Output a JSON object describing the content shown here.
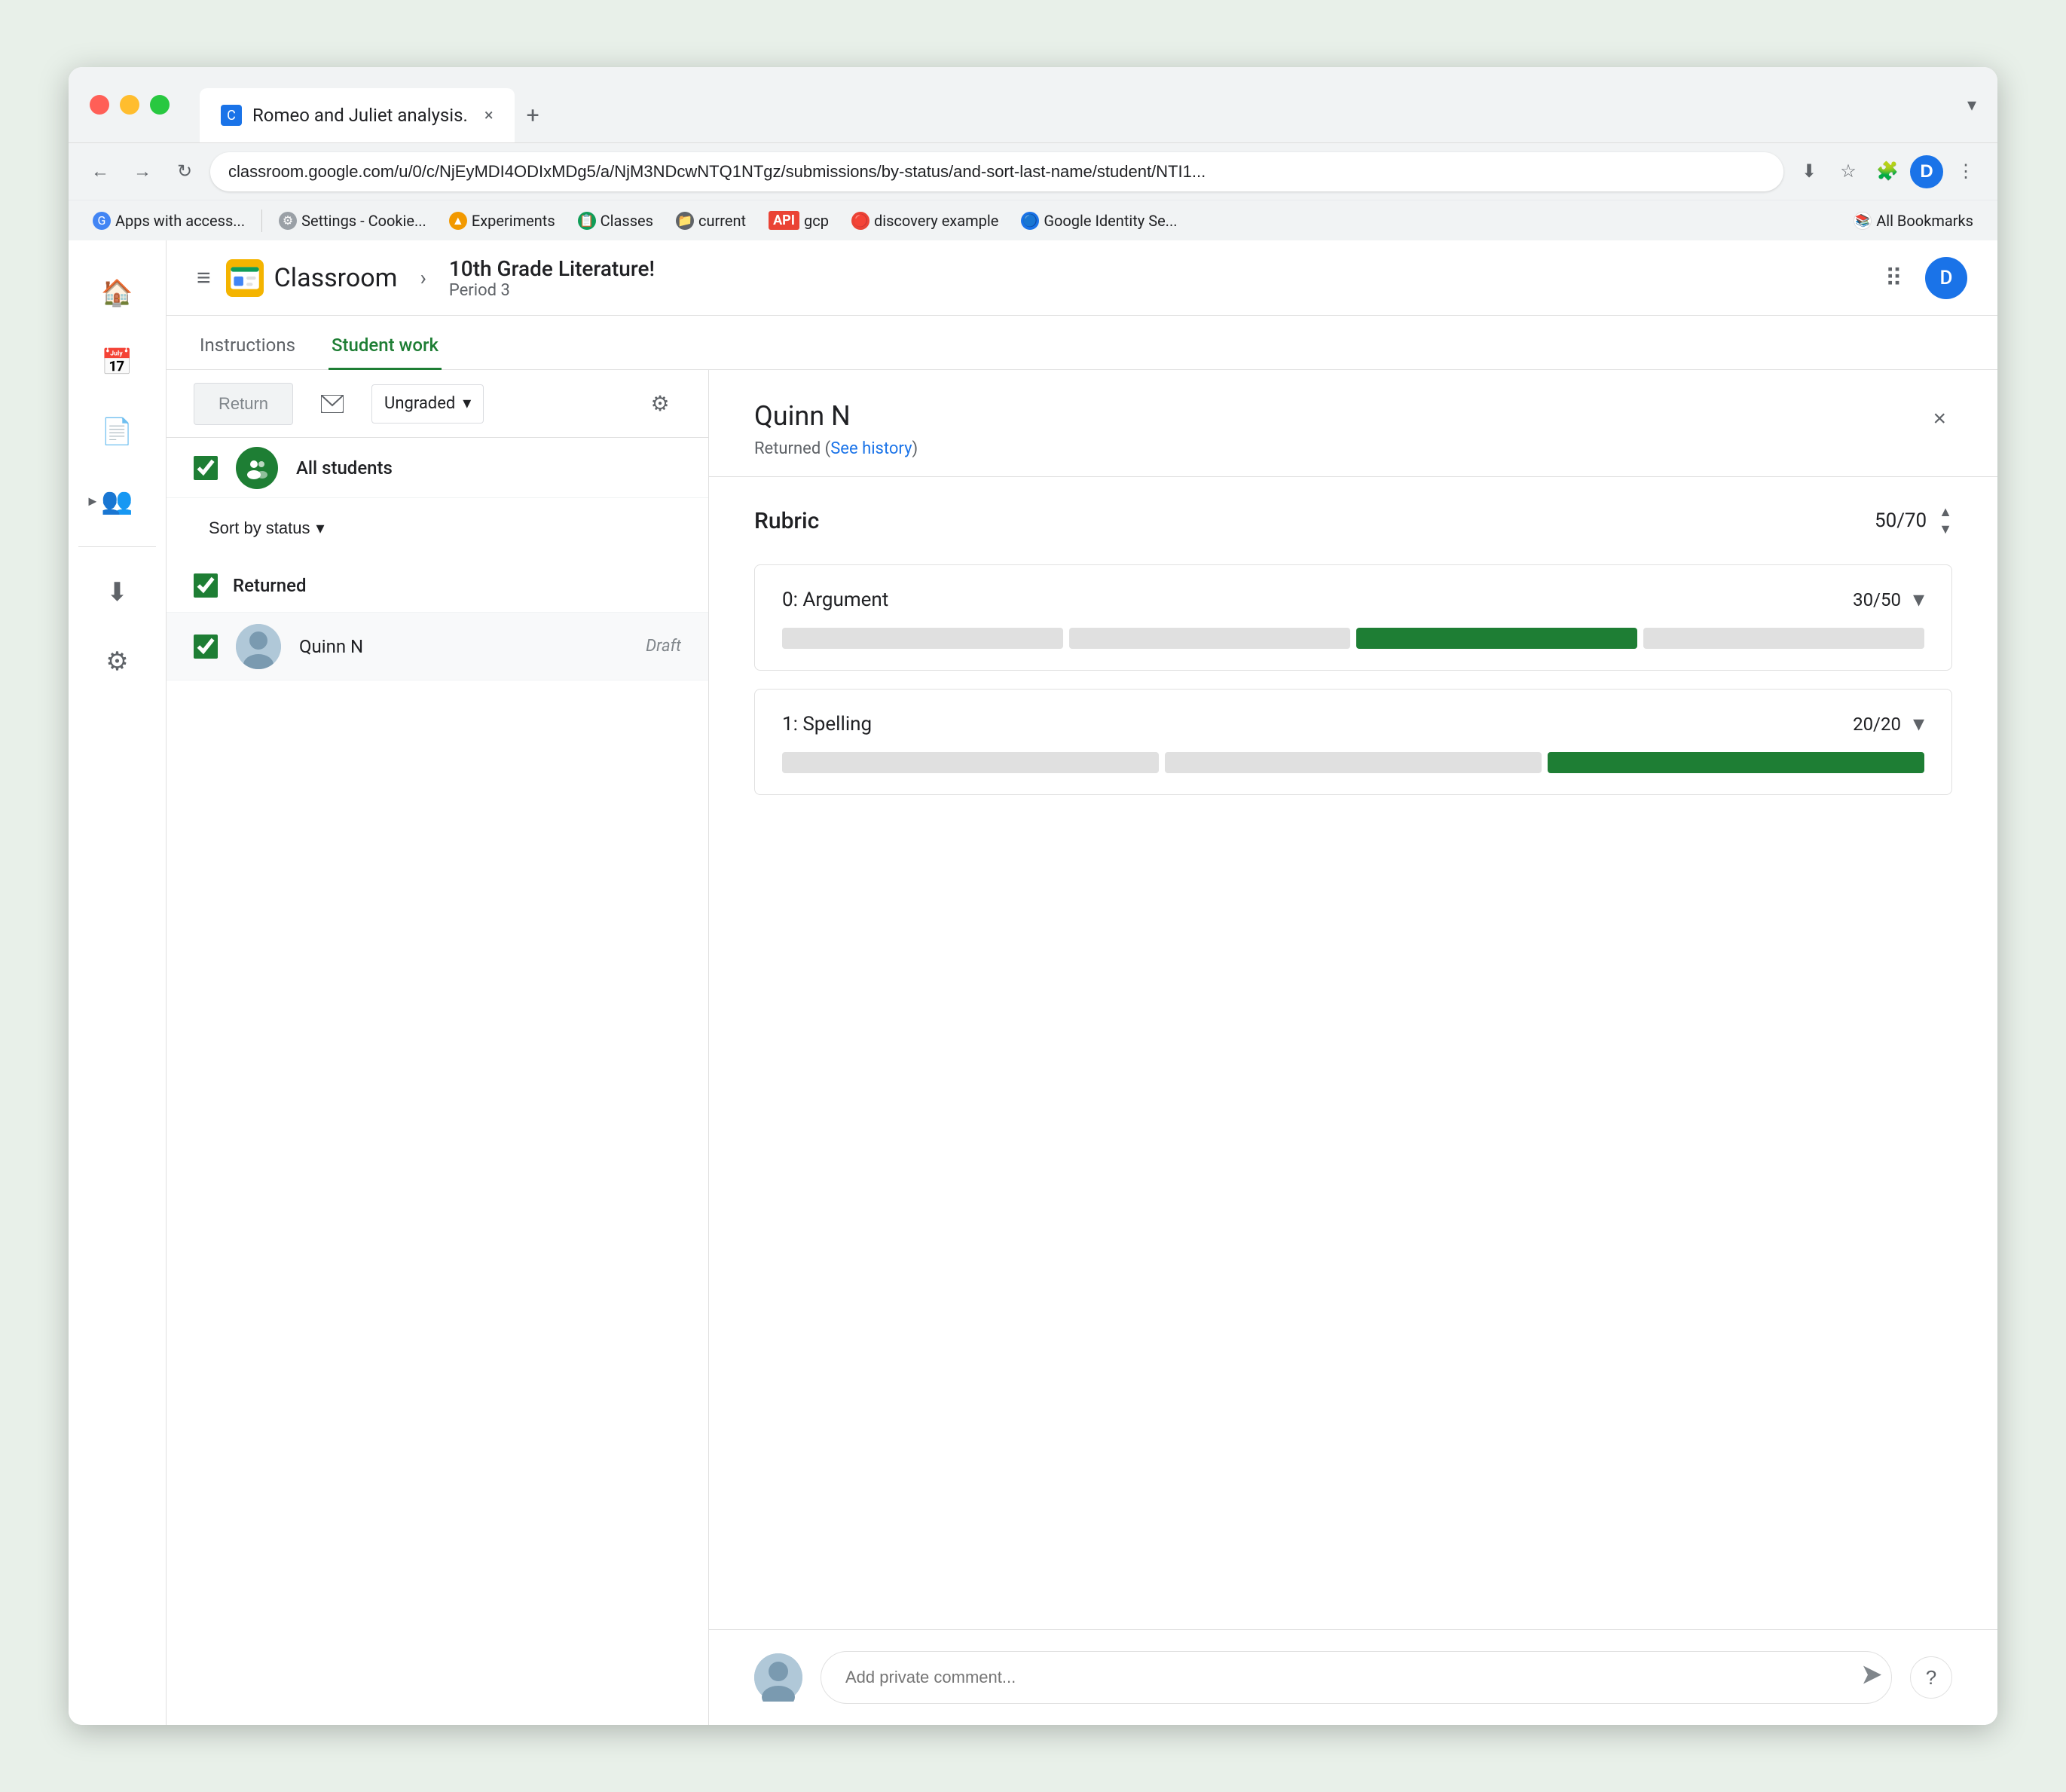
{
  "browser": {
    "tab_title": "Romeo and Juliet analysis.",
    "tab_close": "×",
    "tab_new": "+",
    "address": "classroom.google.com/u/0/c/NjEyMDI4ODIxMDg5/a/NjM3NDcwNTQ1NTgz/submissions/by-status/and-sort-last-name/student/NTI1...",
    "chevron_down": "▾",
    "bookmarks": [
      {
        "label": "Apps with access...",
        "icon": "G",
        "type": "google"
      },
      {
        "label": "Settings - Cookie...",
        "icon": "⚙",
        "type": "settings"
      },
      {
        "label": "Experiments",
        "icon": "🧪",
        "type": "experiments"
      },
      {
        "label": "Classes",
        "icon": "📋",
        "type": "classes"
      },
      {
        "label": "current",
        "icon": "📁",
        "type": "folder"
      },
      {
        "label": "gcp",
        "icon": "☁",
        "type": "gcp"
      },
      {
        "label": "discovery example",
        "icon": "🔴",
        "type": "disc"
      },
      {
        "label": "Google Identity Se...",
        "icon": "🔵",
        "type": "gis"
      },
      {
        "label": "All Bookmarks",
        "icon": "📚",
        "type": "allbookmarks"
      }
    ]
  },
  "app": {
    "menu_icon": "≡",
    "logo_text": "Classroom",
    "breadcrumb_sep": "›",
    "class_name": "10th Grade Literature!",
    "class_period": "Period 3",
    "apps_icon": "⠿",
    "user_initial": "D",
    "header_right_icon": "⋮"
  },
  "tabs": {
    "instructions": "Instructions",
    "student_work": "Student work"
  },
  "toolbar": {
    "return_label": "Return",
    "email_icon": "✉",
    "grade_label": "Ungraded",
    "settings_icon": "⚙"
  },
  "left_nav": {
    "items": [
      {
        "icon": "🏠",
        "name": "home"
      },
      {
        "icon": "📅",
        "name": "calendar"
      },
      {
        "icon": "📄",
        "name": "assignments"
      },
      {
        "icon": "👥",
        "name": "people",
        "expandable": true
      },
      {
        "icon": "⬇",
        "name": "download"
      },
      {
        "icon": "⚙",
        "name": "settings"
      }
    ]
  },
  "student_list": {
    "all_students_label": "All students",
    "sort_label": "Sort by status",
    "sort_icon": "▾",
    "section_returned": "Returned",
    "student": {
      "name": "Quinn N",
      "status": "Draft"
    }
  },
  "detail": {
    "student_name": "Quinn N",
    "student_status": "Returned (See history)",
    "see_history_label": "See history",
    "close_icon": "×",
    "rubric": {
      "title": "Rubric",
      "total_score": "50",
      "total_max": "70",
      "score_display": "50/70",
      "criteria": [
        {
          "name": "0: Argument",
          "score": "30",
          "max": "50",
          "score_display": "30/50",
          "segments": [
            {
              "active": false
            },
            {
              "active": false
            },
            {
              "active": true
            },
            {
              "active": false
            }
          ]
        },
        {
          "name": "1: Spelling",
          "score": "20",
          "max": "20",
          "score_display": "20/20",
          "segments": [
            {
              "active": false
            },
            {
              "active": false
            },
            {
              "active": true
            }
          ]
        }
      ]
    },
    "comment_placeholder": "Add private comment...",
    "send_icon": "➤",
    "help_icon": "?"
  }
}
